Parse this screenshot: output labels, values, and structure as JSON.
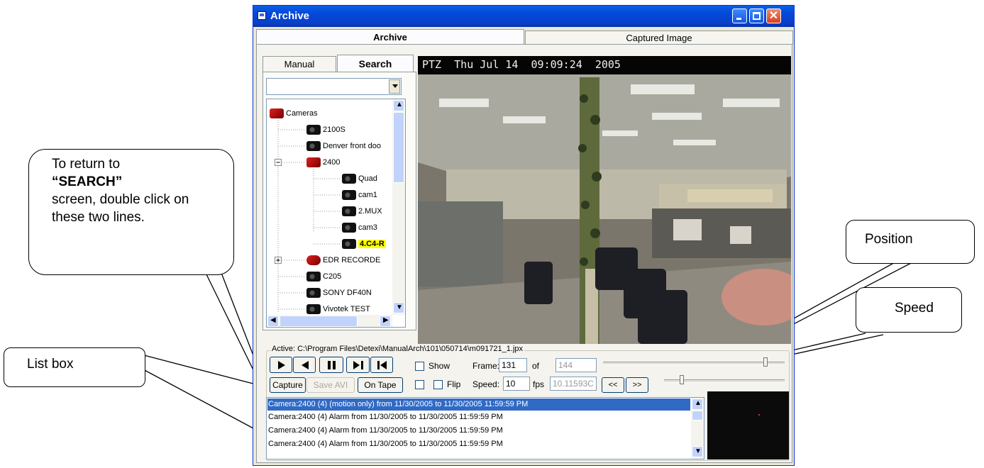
{
  "window": {
    "title": "Archive"
  },
  "tabs": {
    "archive": "Archive",
    "captured": "Captured Image"
  },
  "subtabs": {
    "manual": "Manual",
    "search": "Search"
  },
  "tree": [
    {
      "label": "Cameras",
      "icon": "folder-camera-icon",
      "level": 0
    },
    {
      "label": "2100S",
      "icon": "camera-icon",
      "level": 1
    },
    {
      "label": "Denver front doo",
      "icon": "camera-icon",
      "level": 1
    },
    {
      "label": "2400",
      "icon": "folder-camera-icon",
      "level": 1
    },
    {
      "label": "Quad",
      "icon": "camera-icon",
      "level": 2
    },
    {
      "label": "cam1",
      "icon": "camera-icon",
      "level": 2
    },
    {
      "label": "2.MUX",
      "icon": "camera-icon",
      "level": 2
    },
    {
      "label": "cam3",
      "icon": "camera-icon",
      "level": 2
    },
    {
      "label": "4.C4-R",
      "icon": "camera-icon",
      "level": 2,
      "highlight": true
    },
    {
      "label": "EDR RECORDE",
      "icon": "recorder-icon",
      "level": 1
    },
    {
      "label": "C205",
      "icon": "camera-icon",
      "level": 1
    },
    {
      "label": "SONY DF40N",
      "icon": "camera-icon",
      "level": 1
    },
    {
      "label": "Vivotek TEST",
      "icon": "camera-icon",
      "level": 1
    }
  ],
  "video": {
    "overlay": "PTZ  Thu Jul 14  09:09:24  2005"
  },
  "controls": {
    "active_path": "Active: C:\\Program Files\\Detexi\\ManualArch\\101\\050714\\m091721_1.jpx",
    "capture": "Capture",
    "save_avi": "Save AVI",
    "on_tape": "On Tape",
    "show": "Show",
    "flip": "Flip",
    "frame_label": "Frame:",
    "frame_value": "131",
    "of_label": "of",
    "total_frames": "144",
    "speed_label": "Speed:",
    "speed_value": "10",
    "fps_label": "fps",
    "fps_value": "10.11593C",
    "rewind": "<<",
    "forward": ">>"
  },
  "list": [
    "Camera:2400 (4) (motion only) from 11/30/2005 to 11/30/2005 11:59:59 PM",
    "Camera:2400 (4) Alarm from 11/30/2005 to 11/30/2005 11:59:59 PM",
    "Camera:2400 (4) Alarm from 11/30/2005 to 11/30/2005 11:59:59 PM",
    "Camera:2400 (4) Alarm from 11/30/2005 to 11/30/2005 11:59:59 PM"
  ],
  "callouts": {
    "search_prefix": "To return to",
    "search_bold": "“SEARCH”",
    "search_suffix": "screen, double click on these two lines.",
    "list_box": "List box",
    "position": "Position",
    "speed": "Speed"
  },
  "colors": {
    "title_bar": "#0a5fe8",
    "selection": "#316ac5",
    "highlight": "#ffff00"
  }
}
